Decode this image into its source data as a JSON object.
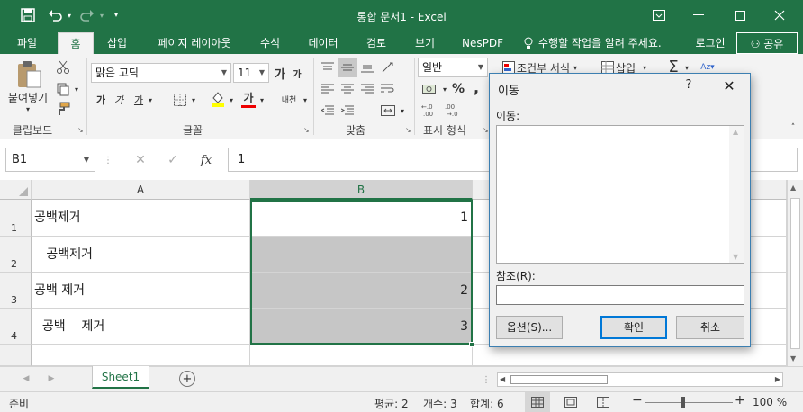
{
  "titlebar": {
    "title": "통합 문서1 - Excel",
    "icons": [
      "save-icon",
      "undo-icon",
      "redo-icon",
      "customize-qat-icon"
    ],
    "window_buttons": [
      "ribbon-display-icon",
      "minimize-icon",
      "maximize-icon",
      "close-icon"
    ]
  },
  "tabs": [
    {
      "label": "파일"
    },
    {
      "label": "홈"
    },
    {
      "label": "삽입"
    },
    {
      "label": "페이지 레이아웃"
    },
    {
      "label": "수식"
    },
    {
      "label": "데이터"
    },
    {
      "label": "검토"
    },
    {
      "label": "보기"
    },
    {
      "label": "NesPDF"
    },
    {
      "label": "수행할 작업을 알려 주세요."
    }
  ],
  "account": {
    "signin": "로그인",
    "share": "공유"
  },
  "ribbon": {
    "clipboard": {
      "paste": "붙여넣기",
      "label": "클립보드"
    },
    "font": {
      "name": "맑은 고딕",
      "size": "11",
      "bold": "가",
      "italic": "가",
      "underline": "가",
      "label": "글꼴",
      "grow": "가",
      "shrink": "가",
      "phonetic": "내천",
      "fontcolor": "가"
    },
    "alignment": {
      "label": "맞춤"
    },
    "number": {
      "format": "일반",
      "percent": "%",
      "comma": ",",
      "label": "표시 형식"
    },
    "styles": {
      "conditional": "조건부 서식"
    },
    "cells": {
      "insert": "삽입"
    }
  },
  "formula_bar": {
    "name_box": "B1",
    "fx": "fx",
    "value": "1"
  },
  "sheet": {
    "columns": [
      "A",
      "B"
    ],
    "rows": [
      "1",
      "2",
      "3",
      "4"
    ],
    "cells_a": [
      "공백제거",
      "   공백제거",
      "공백 제거",
      "  공백    제거"
    ],
    "cells_b": [
      "1",
      "",
      "2",
      "3"
    ]
  },
  "sheet_tabs": {
    "active": "Sheet1",
    "add": "+"
  },
  "status": {
    "ready": "준비",
    "average": "평균: 2",
    "count": "개수: 3",
    "sum": "합계: 6",
    "zoom": "100 %",
    "minus": "−",
    "plus": "+"
  },
  "dialog": {
    "title": "이동",
    "help": "?",
    "close": "✕",
    "go_to_label": "이동:",
    "reference_label": "참조(R):",
    "reference_value": "",
    "special_button": "옵션(S)...",
    "ok_button": "확인",
    "cancel_button": "취소"
  },
  "colors": {
    "excel_green": "#217346",
    "selection_fill": "#c6c6c6",
    "dialog_border": "#3c7fb1"
  }
}
